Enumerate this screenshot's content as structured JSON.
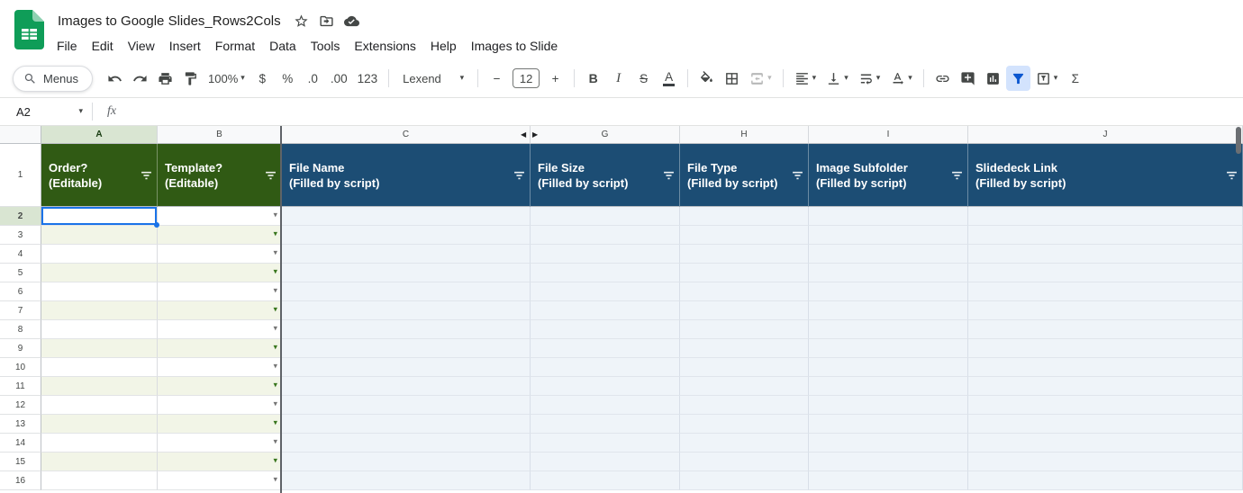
{
  "colors": {
    "header_green": "#305a14",
    "header_blue": "#1c4d74",
    "band_cream": "#f2f5e7",
    "body_blue": "#eff4f9",
    "accent_blue": "#1a73e8",
    "selected_header_bg": "#d9e5d2",
    "filter_active_bg": "#d3e3fd",
    "filter_active_fg": "#0b57d0",
    "logo_green": "#0f9d58",
    "dropdown_green": "#38761d",
    "dropdown_gray": "#757575",
    "frozen_divider": "#5f6368"
  },
  "titlebar": {
    "title": "Images to Google Slides_Rows2Cols"
  },
  "menubar": {
    "items": [
      "File",
      "Edit",
      "View",
      "Insert",
      "Format",
      "Data",
      "Tools",
      "Extensions",
      "Help",
      "Images to Slide"
    ]
  },
  "toolbar": {
    "menus_label": "Menus",
    "zoom_value": "100%",
    "currency": "$",
    "percent": "%",
    "decrease_decimal": ".0",
    "increase_decimal": ".00",
    "number_format": "123",
    "font_name": "Lexend",
    "decrease_font": "−",
    "font_size": "12",
    "increase_font": "+",
    "bold": "B",
    "italic": "I",
    "strikethrough": "S",
    "text_color": "A",
    "functions": "Σ"
  },
  "formula_bar": {
    "name_box": "A2",
    "fx": "fx"
  },
  "grid": {
    "column_letters": [
      "A",
      "B",
      "C",
      "G",
      "H",
      "I",
      "J"
    ],
    "header_row_number": "1",
    "headers": {
      "a": "Order?\n(Editable)",
      "b": "Template?\n(Editable)",
      "c": "File Name\n(Filled by script)",
      "g": "File Size\n(Filled by script)",
      "h": "File Type\n(Filled by script)",
      "i": "Image Subfolder\n(Filled by script)",
      "j": "Slidedeck Link\n(Filled by script)"
    },
    "body_row_numbers": [
      "2",
      "3",
      "4",
      "5",
      "6",
      "7",
      "8",
      "9",
      "10",
      "11",
      "12",
      "13",
      "14",
      "15",
      "16"
    ],
    "selected_cell": "A2"
  }
}
